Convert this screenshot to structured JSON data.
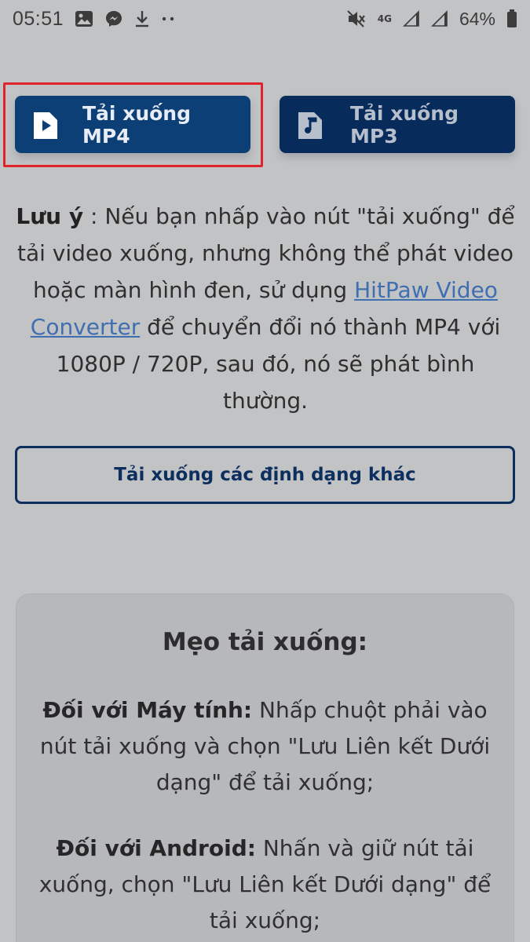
{
  "status_bar": {
    "time": "05:51",
    "network": "4G",
    "battery": "64%",
    "icons": [
      "image-icon",
      "messenger-icon",
      "download-icon",
      "more-dots-icon",
      "mute-icon",
      "signal-icon",
      "battery-icon"
    ]
  },
  "buttons": {
    "mp4_label": "Tải xuống MP4",
    "mp3_label": "Tải xuống MP3",
    "other_formats_label": "Tải xuống các định dạng khác"
  },
  "note": {
    "label": "Lưu ý",
    "text_before_link": " : Nếu bạn nhấp vào nút \"tải xuống\" để tải video xuống, nhưng không thể phát video hoặc màn hình đen, sử dụng ",
    "link_text": "HitPaw Video Converter",
    "text_after_link": " để chuyển đổi nó thành MP4 với 1080P / 720P, sau đó, nó sẽ phát bình thường."
  },
  "tips": {
    "title": "Mẹo tải xuống:",
    "pc_label": "Đối với Máy tính:",
    "pc_text": " Nhấp chuột phải vào nút tải xuống và chọn \"Lưu Liên kết Dưới dạng\" để tải xuống;",
    "android_label": "Đối với Android:",
    "android_text": " Nhấn và giữ nút tải xuống, chọn \"Lưu Liên kết Dưới dạng\" để tải xuống;"
  },
  "colors": {
    "mp4_button": "#0d3f77",
    "mp3_button": "#072c5c",
    "highlight": "#e0242b",
    "link": "#3f6fb0"
  }
}
